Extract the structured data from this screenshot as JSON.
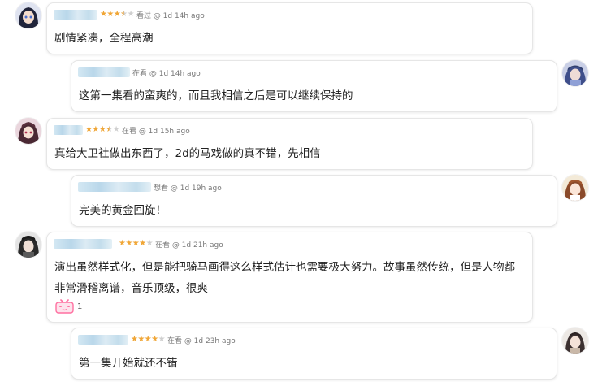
{
  "comments": [
    {
      "rating": "3.5",
      "status": "看过 @ 1d 14h ago",
      "text": "剧情紧凑，全程高潮"
    },
    {
      "rating": "",
      "status": "在看 @ 1d 14h ago",
      "text": "这第一集看的蛮爽的，而且我相信之后是可以继续保持的"
    },
    {
      "rating": "3.5",
      "status": "在看 @ 1d 15h ago",
      "text": "真给大卫社做出东西了，2d的马戏做的真不错，先相信"
    },
    {
      "rating": "",
      "status": "想看 @ 1d 19h ago",
      "text": "完美的黄金回旋！"
    },
    {
      "rating": "4",
      "status": "在看 @ 1d 21h ago",
      "text": "演出虽然样式化，但是能把骑马画得这么样式估计也需要极大努力。故事虽然传统，但是人物都非常滑稽离谱，音乐顶级，很爽",
      "reaction_count": "1",
      "reaction_icon": "tv-icon"
    },
    {
      "rating": "4",
      "status": "在看 @ 1d 23h ago",
      "text": "第一集开始就还不错"
    }
  ],
  "colors": {
    "star": "#f0a636",
    "star_empty": "#cfcfcf",
    "reaction_icon": "#ff6fa0"
  }
}
